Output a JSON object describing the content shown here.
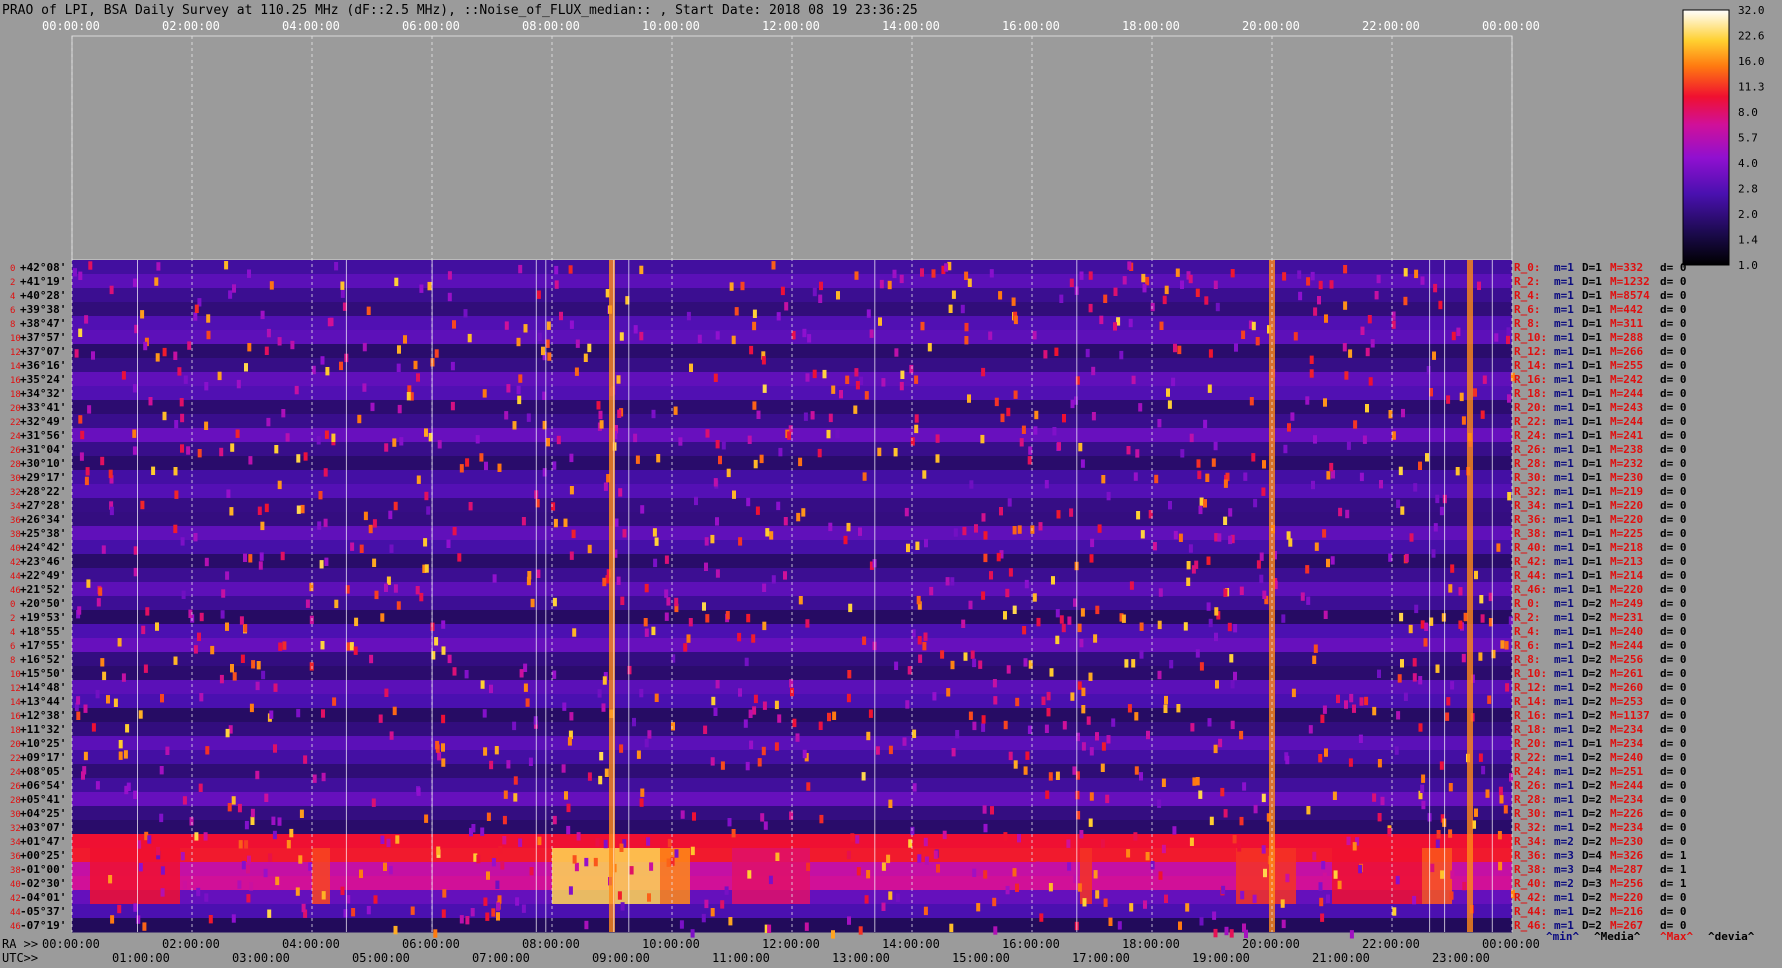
{
  "chart_data": {
    "type": "heatmap",
    "title": "PRAO of LPI, BSA Daily Survey at 110.25 MHz (dF::2.5 MHz), ::Noise_of_FLUX_median:: , Start Date: 2018 08 19 23:36:25",
    "top_axis_ticks": [
      "00:00:00",
      "02:00:00",
      "04:00:00",
      "06:00:00",
      "08:00:00",
      "10:00:00",
      "12:00:00",
      "14:00:00",
      "16:00:00",
      "18:00:00",
      "20:00:00",
      "22:00:00",
      "00:00:00"
    ],
    "ra_label": "RA >>",
    "ra_ticks": [
      "00:00:00",
      "02:00:00",
      "04:00:00",
      "06:00:00",
      "08:00:00",
      "10:00:00",
      "12:00:00",
      "14:00:00",
      "16:00:00",
      "18:00:00",
      "20:00:00",
      "22:00:00",
      "00:00:00"
    ],
    "utc_label": "UTC>>",
    "utc_ticks": [
      "01:00:00",
      "03:00:00",
      "05:00:00",
      "07:00:00",
      "09:00:00",
      "11:00:00",
      "13:00:00",
      "15:00:00",
      "17:00:00",
      "19:00:00",
      "21:00:00",
      "23:00:00"
    ],
    "declinations": [
      "+42°08'",
      "+41°19'",
      "+40°28'",
      "+39°38'",
      "+38°47'",
      "+37°57'",
      "+37°07'",
      "+36°16'",
      "+35°24'",
      "+34°32'",
      "+33°41'",
      "+32°49'",
      "+31°56'",
      "+31°04'",
      "+30°10'",
      "+29°17'",
      "+28°22'",
      "+27°28'",
      "+26°34'",
      "+25°38'",
      "+24°42'",
      "+23°46'",
      "+22°49'",
      "+21°52'",
      "+20°50'",
      "+19°53'",
      "+18°55'",
      "+17°55'",
      "+16°52'",
      "+15°50'",
      "+14°48'",
      "+13°44'",
      "+12°38'",
      "+11°32'",
      "+10°25'",
      "+09°17'",
      "+08°05'",
      "+06°54'",
      "+05°41'",
      "+04°25'",
      "+03°07'",
      "+01°47'",
      "+00°25'",
      "-01°00'",
      "-02°30'",
      "-04°01'",
      "-05°37'",
      "-07°19'"
    ],
    "row_index": [
      "0",
      "2",
      "4",
      "6",
      "8",
      "10",
      "12",
      "14",
      "16",
      "18",
      "20",
      "22",
      "24",
      "26",
      "28",
      "30",
      "32",
      "34",
      "36",
      "38",
      "40",
      "42",
      "44",
      "46",
      "0",
      "2",
      "4",
      "6",
      "8",
      "10",
      "12",
      "14",
      "16",
      "18",
      "20",
      "22",
      "24",
      "26",
      "28",
      "30",
      "32",
      "34",
      "36",
      "38",
      "40",
      "42",
      "44",
      "46"
    ],
    "row_stats": [
      {
        "r": "R_0:",
        "m": "m=1",
        "D": "D=1",
        "M": "M=332",
        "d": "d= 0"
      },
      {
        "r": "R_2:",
        "m": "m=1",
        "D": "D=1",
        "M": "M=1232",
        "d": "d= 0"
      },
      {
        "r": "R_4:",
        "m": "m=1",
        "D": "D=1",
        "M": "M=8574",
        "d": "d= 0"
      },
      {
        "r": "R_6:",
        "m": "m=1",
        "D": "D=1",
        "M": "M=442",
        "d": "d= 0"
      },
      {
        "r": "R_8:",
        "m": "m=1",
        "D": "D=1",
        "M": "M=311",
        "d": "d= 0"
      },
      {
        "r": "R_10:",
        "m": "m=1",
        "D": "D=1",
        "M": "M=288",
        "d": "d= 0"
      },
      {
        "r": "R_12:",
        "m": "m=1",
        "D": "D=1",
        "M": "M=266",
        "d": "d= 0"
      },
      {
        "r": "R_14:",
        "m": "m=1",
        "D": "D=1",
        "M": "M=255",
        "d": "d= 0"
      },
      {
        "r": "R_16:",
        "m": "m=1",
        "D": "D=1",
        "M": "M=242",
        "d": "d= 0"
      },
      {
        "r": "R_18:",
        "m": "m=1",
        "D": "D=1",
        "M": "M=244",
        "d": "d= 0"
      },
      {
        "r": "R_20:",
        "m": "m=1",
        "D": "D=1",
        "M": "M=243",
        "d": "d= 0"
      },
      {
        "r": "R_22:",
        "m": "m=1",
        "D": "D=1",
        "M": "M=244",
        "d": "d= 0"
      },
      {
        "r": "R_24:",
        "m": "m=1",
        "D": "D=1",
        "M": "M=241",
        "d": "d= 0"
      },
      {
        "r": "R_26:",
        "m": "m=1",
        "D": "D=1",
        "M": "M=238",
        "d": "d= 0"
      },
      {
        "r": "R_28:",
        "m": "m=1",
        "D": "D=1",
        "M": "M=232",
        "d": "d= 0"
      },
      {
        "r": "R_30:",
        "m": "m=1",
        "D": "D=1",
        "M": "M=230",
        "d": "d= 0"
      },
      {
        "r": "R_32:",
        "m": "m=1",
        "D": "D=1",
        "M": "M=219",
        "d": "d= 0"
      },
      {
        "r": "R_34:",
        "m": "m=1",
        "D": "D=1",
        "M": "M=220",
        "d": "d= 0"
      },
      {
        "r": "R_36:",
        "m": "m=1",
        "D": "D=1",
        "M": "M=220",
        "d": "d= 0"
      },
      {
        "r": "R_38:",
        "m": "m=1",
        "D": "D=1",
        "M": "M=225",
        "d": "d= 0"
      },
      {
        "r": "R_40:",
        "m": "m=1",
        "D": "D=1",
        "M": "M=218",
        "d": "d= 0"
      },
      {
        "r": "R_42:",
        "m": "m=1",
        "D": "D=1",
        "M": "M=213",
        "d": "d= 0"
      },
      {
        "r": "R_44:",
        "m": "m=1",
        "D": "D=1",
        "M": "M=214",
        "d": "d= 0"
      },
      {
        "r": "R_46:",
        "m": "m=1",
        "D": "D=1",
        "M": "M=220",
        "d": "d= 0"
      },
      {
        "r": "R_0:",
        "m": "m=1",
        "D": "D=2",
        "M": "M=249",
        "d": "d= 0"
      },
      {
        "r": "R_2:",
        "m": "m=1",
        "D": "D=2",
        "M": "M=231",
        "d": "d= 0"
      },
      {
        "r": "R_4:",
        "m": "m=1",
        "D": "D=1",
        "M": "M=240",
        "d": "d= 0"
      },
      {
        "r": "R_6:",
        "m": "m=1",
        "D": "D=2",
        "M": "M=244",
        "d": "d= 0"
      },
      {
        "r": "R_8:",
        "m": "m=1",
        "D": "D=2",
        "M": "M=256",
        "d": "d= 0"
      },
      {
        "r": "R_10:",
        "m": "m=1",
        "D": "D=2",
        "M": "M=261",
        "d": "d= 0"
      },
      {
        "r": "R_12:",
        "m": "m=1",
        "D": "D=2",
        "M": "M=260",
        "d": "d= 0"
      },
      {
        "r": "R_14:",
        "m": "m=1",
        "D": "D=2",
        "M": "M=253",
        "d": "d= 0"
      },
      {
        "r": "R_16:",
        "m": "m=1",
        "D": "D=2",
        "M": "M=1137",
        "d": "d= 0"
      },
      {
        "r": "R_18:",
        "m": "m=1",
        "D": "D=2",
        "M": "M=234",
        "d": "d= 0"
      },
      {
        "r": "R_20:",
        "m": "m=1",
        "D": "D=1",
        "M": "M=234",
        "d": "d= 0"
      },
      {
        "r": "R_22:",
        "m": "m=1",
        "D": "D=2",
        "M": "M=240",
        "d": "d= 0"
      },
      {
        "r": "R_24:",
        "m": "m=1",
        "D": "D=2",
        "M": "M=251",
        "d": "d= 0"
      },
      {
        "r": "R_26:",
        "m": "m=1",
        "D": "D=2",
        "M": "M=244",
        "d": "d= 0"
      },
      {
        "r": "R_28:",
        "m": "m=1",
        "D": "D=2",
        "M": "M=234",
        "d": "d= 0"
      },
      {
        "r": "R_30:",
        "m": "m=1",
        "D": "D=2",
        "M": "M=226",
        "d": "d= 0"
      },
      {
        "r": "R_32:",
        "m": "m=1",
        "D": "D=2",
        "M": "M=234",
        "d": "d= 0"
      },
      {
        "r": "R_34:",
        "m": "m=2",
        "D": "D=2",
        "M": "M=230",
        "d": "d= 0"
      },
      {
        "r": "R_36:",
        "m": "m=3",
        "D": "D=4",
        "M": "M=326",
        "d": "d= 1"
      },
      {
        "r": "R_38:",
        "m": "m=3",
        "D": "D=4",
        "M": "M=287",
        "d": "d= 1"
      },
      {
        "r": "R_40:",
        "m": "m=2",
        "D": "D=3",
        "M": "M=256",
        "d": "d= 1"
      },
      {
        "r": "R_42:",
        "m": "m=1",
        "D": "D=2",
        "M": "M=220",
        "d": "d= 0"
      },
      {
        "r": "R_44:",
        "m": "m=1",
        "D": "D=2",
        "M": "M=216",
        "d": "d= 0"
      },
      {
        "r": "R_46:",
        "m": "m=1",
        "D": "D=2",
        "M": "M=267",
        "d": "d= 0"
      }
    ],
    "stats_footer": {
      "min": "^min^",
      "media": "^Media^",
      "max": "^Max^",
      "devia": "^devia^"
    },
    "colorbar_ticks": [
      "32.0",
      "22.6",
      "16.0",
      "11.3",
      "8.0",
      "5.7",
      "4.0",
      "2.8",
      "2.0",
      "1.4",
      "1.0"
    ],
    "colorbar_scale": "log",
    "colorbar_range": [
      1.0,
      32.0
    ],
    "hot_features": [
      {
        "ra_hours": 20.0,
        "note": "vertical bright streak"
      },
      {
        "ra_hours": 23.3,
        "note": "vertical bright streak"
      },
      {
        "ra_hours": 9.0,
        "note": "bright band at low declination"
      }
    ],
    "grid": true
  }
}
